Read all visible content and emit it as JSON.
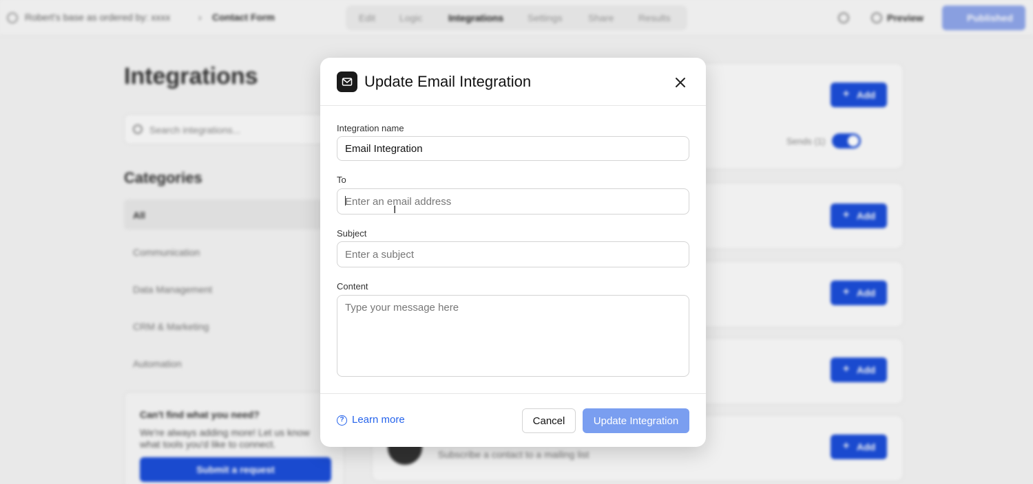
{
  "topbar": {
    "breadcrumb_workspace": "Robert's base as ordered by: xxxx",
    "breadcrumb_form": "Contact Form",
    "tabs": [
      "Edit",
      "Logic",
      "Integrations",
      "Settings",
      "Share",
      "Results"
    ],
    "active_tab": "Integrations",
    "preview_label": "Preview",
    "publish_label": "Published"
  },
  "sidebar": {
    "page_title": "Integrations",
    "search_placeholder": "Search integrations...",
    "categories_title": "Categories",
    "categories": [
      "All",
      "Communication",
      "Data Management",
      "CRM & Marketing",
      "Automation"
    ],
    "help": {
      "title": "Can't find what you need?",
      "text": "We're always adding more! Let us know what tools you'd like to connect.",
      "button": "Submit a request"
    }
  },
  "cards": {
    "add_label": "Add",
    "sends_label": "Sends (1)",
    "last_card_desc": "Subscribe a contact to a mailing list"
  },
  "modal": {
    "title": "Update Email Integration",
    "icon": "mail-icon",
    "fields": {
      "name_label": "Integration name",
      "name_value": "Email Integration",
      "to_label": "To",
      "to_placeholder": "Enter an email address",
      "subject_label": "Subject",
      "subject_placeholder": "Enter a subject",
      "content_label": "Content",
      "content_placeholder": "Type your message here"
    },
    "footer": {
      "learn_more": "Learn more",
      "cancel": "Cancel",
      "submit": "Update Integration"
    }
  },
  "colors": {
    "primary": "#1c4ed8",
    "primary_disabled": "#7a9ef0",
    "link": "#2563eb"
  }
}
